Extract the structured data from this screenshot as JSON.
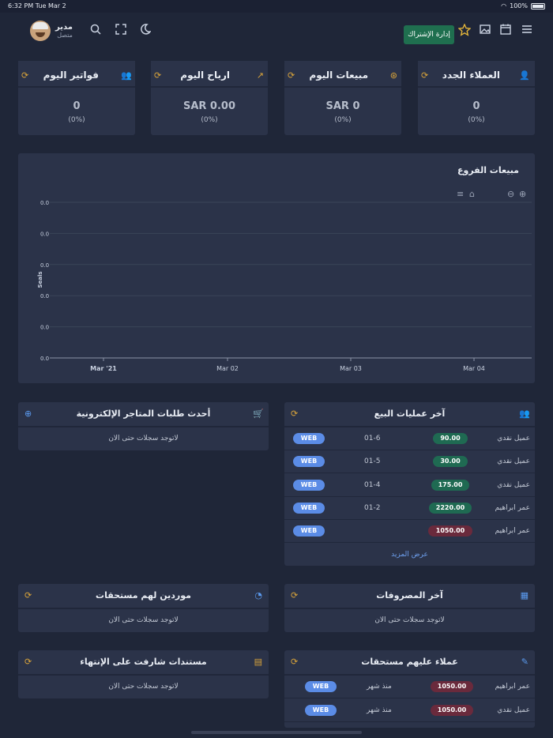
{
  "status_bar": {
    "time": "6:32 PM  Tue Mar 2",
    "battery": "100%"
  },
  "header": {
    "user_name": "مدير",
    "user_status": "متصل",
    "subscription_button": "إدارة الإشتراك"
  },
  "stats": [
    {
      "title": "العملاء الجدد",
      "value": "0",
      "pct": "(0%)"
    },
    {
      "title": "مبيعات اليوم",
      "value": "SAR 0",
      "pct": "(0%)"
    },
    {
      "title": "ارباح اليوم",
      "value": "SAR 0.00",
      "pct": "(0%)"
    },
    {
      "title": "فواتير اليوم",
      "value": "0",
      "pct": "(0%)"
    }
  ],
  "chart_data": {
    "type": "line",
    "title": "مبيعات الفروع",
    "ylabel": "Seals",
    "xlabel": "",
    "x": [
      "Mar '21",
      "Mar 02",
      "Mar 03",
      "Mar 04"
    ],
    "yticks": [
      "0.0",
      "0.0",
      "0.0",
      "0.0",
      "0.0",
      "0.0"
    ],
    "series": [],
    "grid": true
  },
  "sales": {
    "title": "آخر عمليات البيع",
    "more": "عرض المزيد",
    "rows": [
      {
        "customer": "عميل نقدي",
        "amount": "90.00",
        "date": "01-6",
        "source": "WEB",
        "tone": "green"
      },
      {
        "customer": "عميل نقدي",
        "amount": "30.00",
        "date": "01-5",
        "source": "WEB",
        "tone": "green"
      },
      {
        "customer": "عميل نقدي",
        "amount": "175.00",
        "date": "01-4",
        "source": "WEB",
        "tone": "green"
      },
      {
        "customer": "عمر ابراهيم",
        "amount": "2220.00",
        "date": "01-2",
        "source": "WEB",
        "tone": "green"
      },
      {
        "customer": "عمر ابراهيم",
        "amount": "1050.00",
        "date": "",
        "source": "WEB",
        "tone": "red"
      }
    ]
  },
  "orders": {
    "title": "أحدث طلبات المتاجر الإلكترونية",
    "empty": "لاتوجد سجلات حتى الان"
  },
  "expenses": {
    "title": "آخر المصروفات",
    "empty": "لاتوجد سجلات حتى الان"
  },
  "suppliers": {
    "title": "موردين لهم مستحقات",
    "empty": "لاتوجد سجلات حتى الان"
  },
  "documents": {
    "title": "مستندات شارفت على الإنتهاء",
    "empty": "لاتوجد سجلات حتى الان"
  },
  "debtors": {
    "title": "عملاء عليهم مستحقات",
    "rows": [
      {
        "customer": "عمر ابراهيم",
        "amount": "1050.00",
        "since": "منذ شهر",
        "source": "WEB"
      },
      {
        "customer": "عميل نقدي",
        "amount": "1050.00",
        "since": "منذ شهر",
        "source": "WEB"
      }
    ]
  }
}
